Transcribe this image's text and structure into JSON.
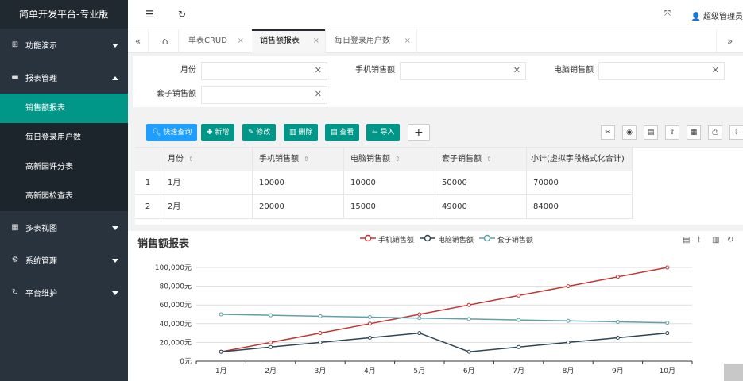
{
  "app": {
    "title": "简单开发平台-专业版"
  },
  "sidebar": {
    "menus": [
      {
        "label": "功能演示",
        "icon": "puzzle-icon"
      },
      {
        "label": "报表管理",
        "icon": "report-icon",
        "expanded": true,
        "children": [
          "销售额报表",
          "每日登录用户数",
          "高新园评分表",
          "高新园检查表"
        ]
      },
      {
        "label": "多表视图",
        "icon": "grid-icon"
      },
      {
        "label": "系统管理",
        "icon": "gear-icon"
      },
      {
        "label": "平台维护",
        "icon": "wrench-icon"
      }
    ]
  },
  "header": {
    "user": "超级管理员"
  },
  "tabs": [
    "单表CRUD",
    "销售额报表",
    "每日登录用户数"
  ],
  "form": {
    "labels": [
      "月份",
      "手机销售额",
      "电脑销售额",
      "套子销售额"
    ]
  },
  "toolbar": {
    "buttons": [
      "快速查询",
      "新增",
      "修改",
      "删除",
      "查看",
      "导入",
      "+"
    ]
  },
  "table": {
    "columns": [
      "月份",
      "手机销售额",
      "电脑销售额",
      "套子销售额",
      "小计(虚拟字段格式化合计)"
    ],
    "rows": [
      [
        "1",
        "1月",
        "10000",
        "10000",
        "50000",
        "70000"
      ],
      [
        "2",
        "2月",
        "20000",
        "15000",
        "49000",
        "84000"
      ]
    ]
  },
  "chart_data": {
    "type": "line",
    "title": "销售额报表",
    "categories": [
      "1月",
      "2月",
      "3月",
      "4月",
      "5月",
      "6月",
      "7月",
      "8月",
      "9月",
      "10月"
    ],
    "series": [
      {
        "name": "手机销售额",
        "color": "#c23531",
        "values": [
          10000,
          20000,
          30000,
          40000,
          50000,
          60000,
          70000,
          80000,
          90000,
          100000
        ]
      },
      {
        "name": "电脑销售额",
        "color": "#2f4554",
        "values": [
          10000,
          15000,
          20000,
          25000,
          30000,
          10000,
          15000,
          20000,
          25000,
          30000
        ]
      },
      {
        "name": "套子销售额",
        "color": "#61a0a8",
        "values": [
          50000,
          49000,
          48000,
          47000,
          46000,
          45000,
          44000,
          43000,
          42000,
          41000
        ]
      }
    ],
    "y_ticks": [
      "0元",
      "20,000元",
      "40,000元",
      "60,000元",
      "80,000元",
      "100,000元"
    ],
    "ylim": [
      0,
      100000
    ],
    "grid": true,
    "legend": "top-center"
  },
  "colors": {
    "accent": "#009688",
    "sidebar": "#28333e",
    "blue": "#1e9fff"
  }
}
